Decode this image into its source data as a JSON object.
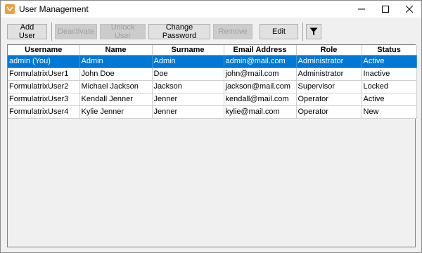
{
  "window": {
    "title": "User Management",
    "accent_color": "#f0a040",
    "icons": {
      "app": "app-logo-icon",
      "minimize": "minimize-icon",
      "maximize": "maximize-icon",
      "close": "close-icon"
    }
  },
  "toolbar": {
    "add_user": "Add User",
    "deactivate": "Deactivate",
    "unlock_user": "Unlock User",
    "change_password": "Change Password",
    "remove": "Remove",
    "edit": "Edit",
    "filter_icon": "filter-icon"
  },
  "table": {
    "columns": [
      "Username",
      "Name",
      "Surname",
      "Email Address",
      "Role",
      "Status"
    ],
    "selection_color": "#0078d7",
    "rows": [
      [
        "admin (You)",
        "Admin",
        "Admin",
        "admin@mail.com",
        "Administrator",
        "Active"
      ],
      [
        "FormulatrixUser1",
        "John Doe",
        "Doe",
        "john@mail.com",
        "Administrator",
        "Inactive"
      ],
      [
        "FormulatrixUser2",
        "Michael Jackson",
        "Jackson",
        "jackson@mail.com",
        "Supervisor",
        "Locked"
      ],
      [
        "FormulatrixUser3",
        "Kendall Jenner",
        "Jenner",
        "kendall@mail.com",
        "Operator",
        "Active"
      ],
      [
        "FormulatrixUser4",
        "Kylie Jenner",
        "Jenner",
        "kylie@mail.com",
        "Operator",
        "New"
      ]
    ]
  }
}
